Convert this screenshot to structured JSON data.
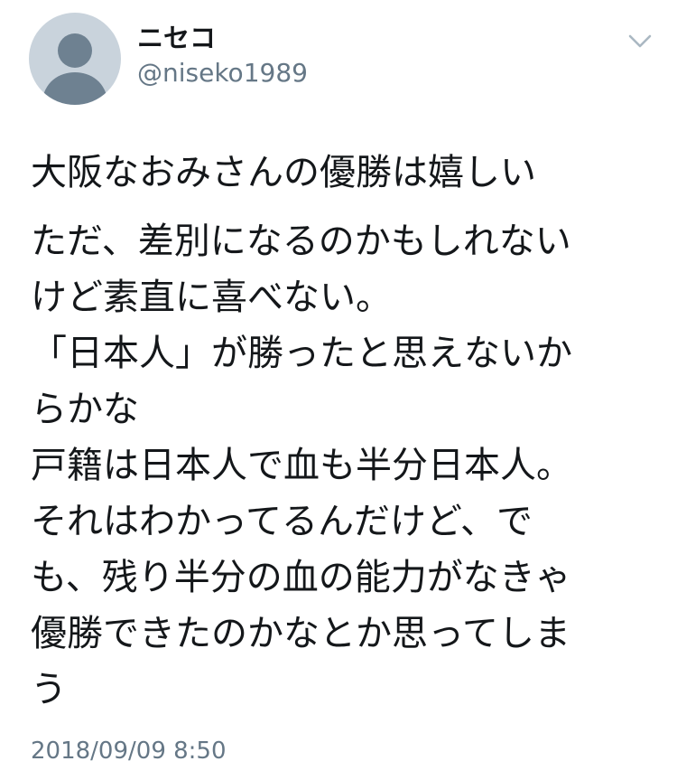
{
  "user": {
    "display_name": "ニセコ",
    "handle": "@niseko1989",
    "avatar_icon": "default-profile-icon"
  },
  "menu": {
    "icon": "chevron-down-icon"
  },
  "tweet": {
    "paragraphs": [
      [
        "大阪なおみさんの優勝は嬉しい"
      ],
      [
        "ただ、差別になるのかもしれない",
        "けど素直に喜べない。",
        "「日本人」が勝ったと思えないか",
        "らかな",
        "戸籍は日本人で血も半分日本人。",
        "それはわかってるんだけど、で",
        "も、残り半分の血の能力がなきゃ",
        "優勝できたのかなとか思ってしま",
        "う"
      ]
    ],
    "timestamp": "2018/09/09 8:50"
  },
  "colors": {
    "text_primary": "#14171a",
    "text_secondary": "#657786",
    "avatar_bg": "#c9d3dc",
    "avatar_fg": "#6e8191"
  }
}
